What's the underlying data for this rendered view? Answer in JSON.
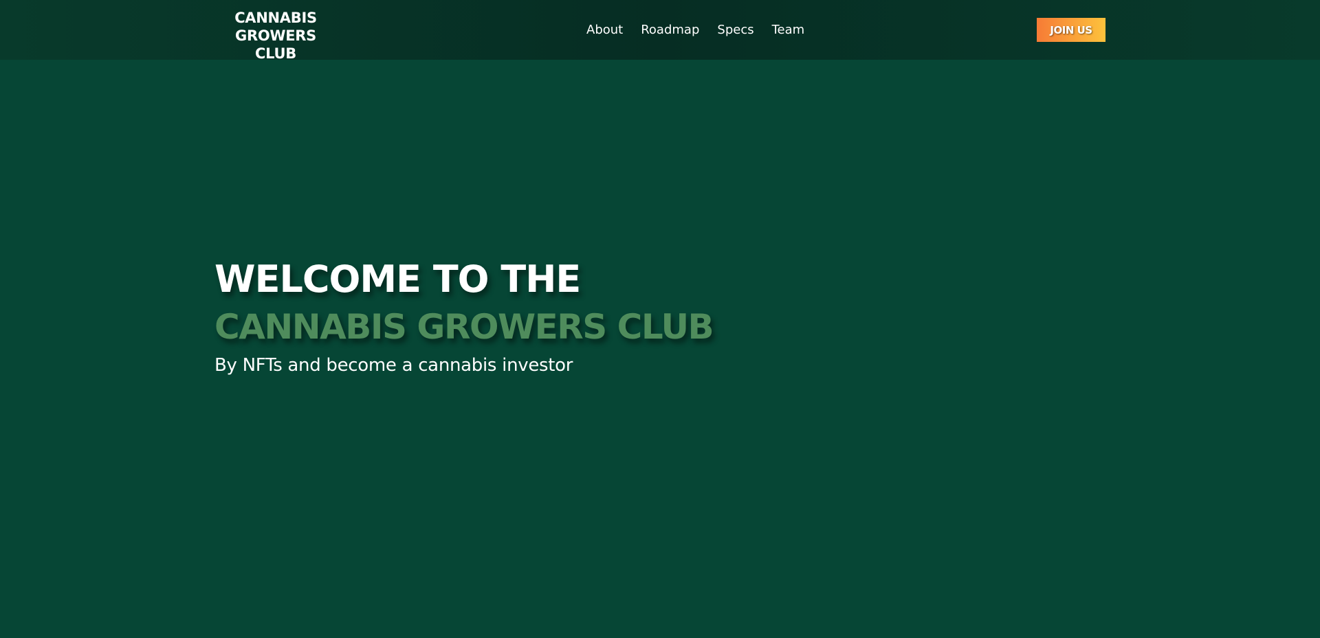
{
  "navbar": {
    "brand_line1": "CANNABIS",
    "brand_line2": "GROWERS CLUB",
    "links": [
      {
        "label": "About"
      },
      {
        "label": "Roadmap"
      },
      {
        "label": "Specs"
      },
      {
        "label": "Team"
      }
    ],
    "cta_label": "JOIN US"
  },
  "hero": {
    "title_line1": "WELCOME TO THE",
    "title_line2": "CANNABIS GROWERS CLUB",
    "subtitle": "By NFTs and become a cannabis investor"
  },
  "colors": {
    "page_background": "#064635",
    "navbar_background": "#062d23",
    "accent_green": "#4f8c5c",
    "cta_gradient_start": "#f67b36",
    "cta_gradient_end": "#fdc23c"
  }
}
